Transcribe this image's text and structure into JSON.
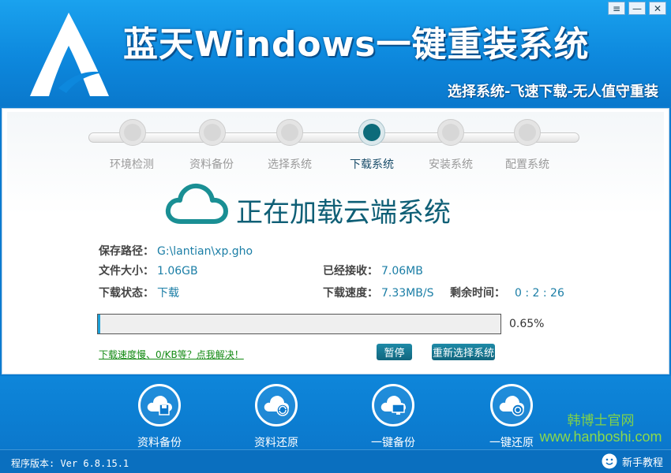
{
  "window": {
    "menu_glyph": "≡",
    "minimize_glyph": "—",
    "close_glyph": "✕"
  },
  "header": {
    "title": "蓝天Windows一键重装系统",
    "subtitle": "选择系统-飞速下载-无人值守重装",
    "logo_icon": "stylized-A-logo"
  },
  "steps": [
    {
      "label": "环境检测",
      "active": false
    },
    {
      "label": "资料备份",
      "active": false
    },
    {
      "label": "选择系统",
      "active": false
    },
    {
      "label": "下载系统",
      "active": true
    },
    {
      "label": "安装系统",
      "active": false
    },
    {
      "label": "配置系统",
      "active": false
    }
  ],
  "loading": {
    "title": "正在加载云端系统",
    "icon": "cloud-icon"
  },
  "info": {
    "save_path_label": "保存路径：",
    "save_path": "G:\\lantian\\xp.gho",
    "file_size_label": "文件大小：",
    "file_size": "1.06GB",
    "received_label": "已经接收：",
    "received": "7.06MB",
    "status_label": "下载状态：",
    "status": "下载",
    "speed_label": "下载速度：",
    "speed": "7.33MB/S",
    "remaining_label": "剩余时间：",
    "remaining": "0 : 2 : 26"
  },
  "progress": {
    "percent_text": "0.65%",
    "value": 0.0065
  },
  "actions": {
    "help_link": "下载速度慢、0/KB等？点我解决！",
    "pause": "暂停",
    "reselect": "重新选择系统"
  },
  "toolbar": [
    {
      "label": "资料备份",
      "icon": "cloud-save-icon"
    },
    {
      "label": "资料还原",
      "icon": "cloud-restore-icon"
    },
    {
      "label": "一键备份",
      "icon": "cloud-monitor-icon"
    },
    {
      "label": "一键还原",
      "icon": "cloud-power-icon"
    }
  ],
  "watermark": {
    "line1": "韩博士官网",
    "line2": "www.hanboshi.com"
  },
  "status_bar": {
    "version": "程序版本: Ver 6.8.15.1",
    "tutorial": "新手教程"
  },
  "colors": {
    "header_blue": "#1aa2ee",
    "teal_accent": "#0f5f76",
    "progress_fill": "#1c9fd6",
    "link_green": "#138a13"
  }
}
